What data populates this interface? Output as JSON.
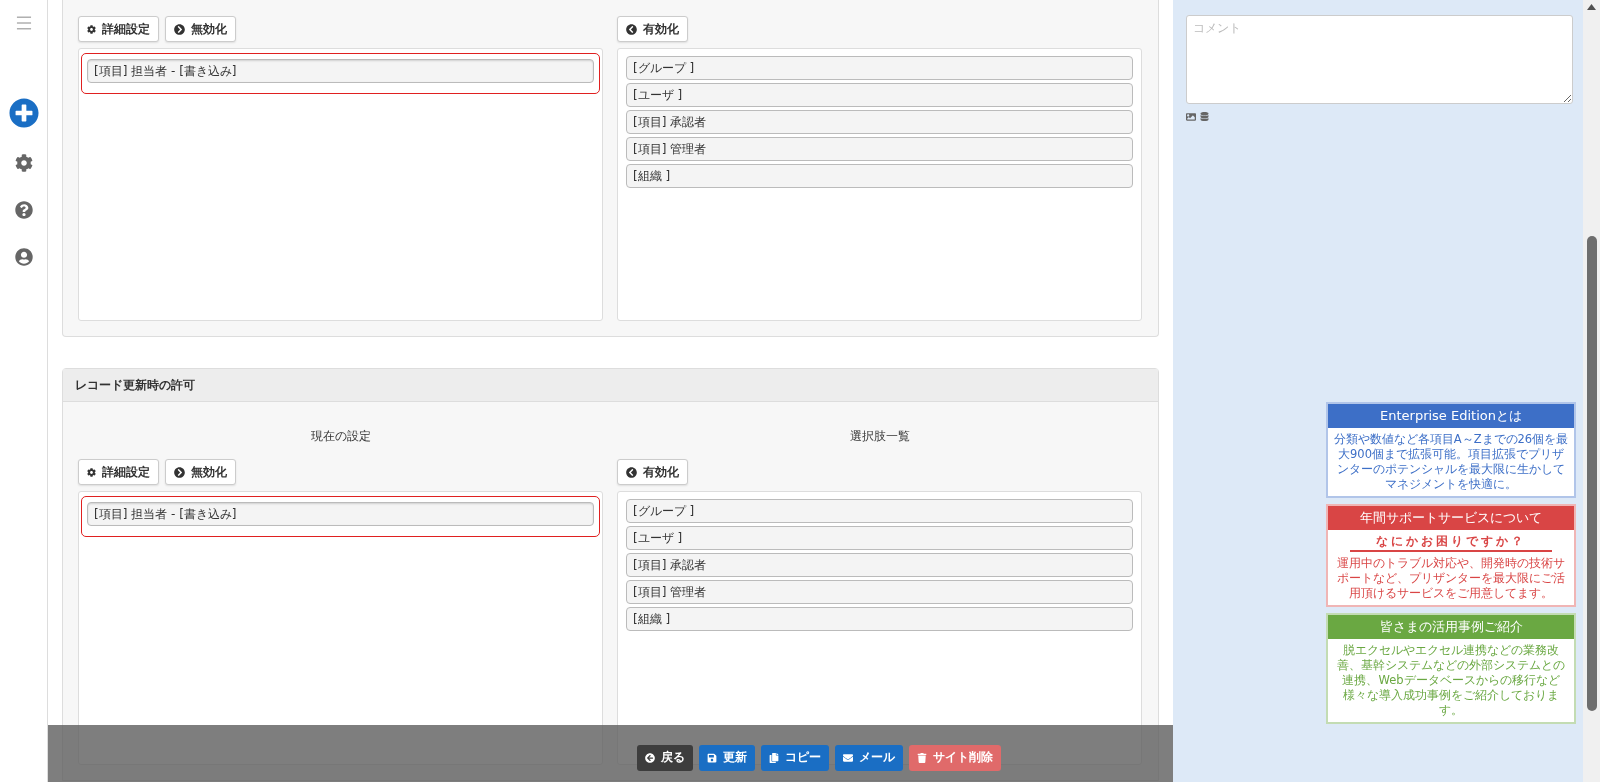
{
  "sidebar": {
    "items": [
      {
        "kind": "menu"
      },
      {
        "kind": "add"
      },
      {
        "kind": "settings"
      },
      {
        "kind": "help"
      },
      {
        "kind": "user"
      }
    ]
  },
  "panels": [
    {
      "detail_button": "詳細設定",
      "disable_button": "無効化",
      "enable_button": "有効化",
      "current": [
        {
          "label": "[項目] 担当者 - [書き込み]",
          "selected": true
        }
      ],
      "options": [
        {
          "label": "[グループ ]",
          "selected": false
        },
        {
          "label": "[ユーザ ]",
          "selected": false
        },
        {
          "label": "[項目] 承認者",
          "selected": false
        },
        {
          "label": "[項目] 管理者",
          "selected": false
        },
        {
          "label": "[組織 ]",
          "selected": false
        }
      ]
    },
    {
      "header": "レコード更新時の許可",
      "current_label": "現在の設定",
      "options_label": "選択肢一覧",
      "detail_button": "詳細設定",
      "disable_button": "無効化",
      "enable_button": "有効化",
      "current": [
        {
          "label": "[項目] 担当者 - [書き込み]",
          "selected": true
        }
      ],
      "options": [
        {
          "label": "[グループ ]",
          "selected": false
        },
        {
          "label": "[ユーザ ]",
          "selected": false
        },
        {
          "label": "[項目] 承認者",
          "selected": false
        },
        {
          "label": "[項目] 管理者",
          "selected": false
        },
        {
          "label": "[組織 ]",
          "selected": false
        }
      ]
    }
  ],
  "comment": {
    "placeholder": "コメント"
  },
  "ads": [
    {
      "title": "Enterprise Editionとは",
      "color": "#3d6fc7",
      "body": "分類や数値など各項目A～Zまでの26個を最大900個まで拡張可能。項目拡張でプリザンターのポテンシャルを最大限に生かしてマネジメントを快適に。"
    },
    {
      "title": "年間サポートサービスについて",
      "color": "#d94545",
      "subtitle": "なにかお困りですか？",
      "body": "運用中のトラブル対応や、開発時の技術サポートなど、プリザンターを最大限にご活用頂けるサービスをご用意してます。"
    },
    {
      "title": "皆さまの活用事例ご紹介",
      "color": "#6aa842",
      "body": "脱エクセルやエクセル連携などの業務改善、基幹システムなどの外部システムとの連携、Webデータベースからの移行など様々な導入成功事例をご紹介しております。"
    }
  ],
  "actions": [
    {
      "label": "戻る",
      "kind": "back"
    },
    {
      "label": "更新",
      "kind": "update"
    },
    {
      "label": "コピー",
      "kind": "copy"
    },
    {
      "label": "メール",
      "kind": "mail"
    },
    {
      "label": "サイト削除",
      "kind": "delete"
    }
  ]
}
